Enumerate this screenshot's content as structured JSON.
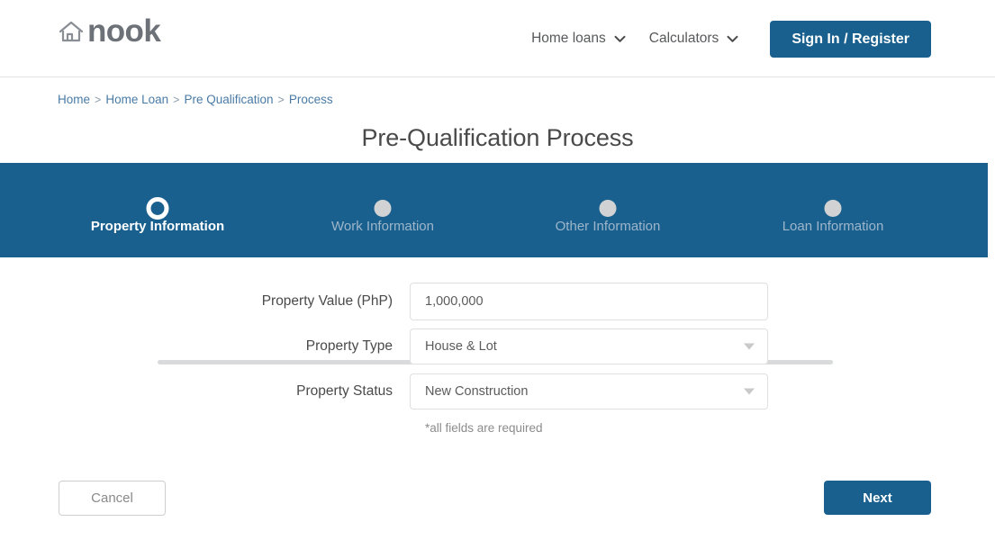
{
  "header": {
    "logo": {
      "icon": "house-icon",
      "text": "nook"
    },
    "nav_items": [
      {
        "label": "Home loans",
        "icon": "chevron-down-icon"
      },
      {
        "label": "Calculators",
        "icon": "chevron-down-icon"
      }
    ],
    "signin_label": "Sign In / Register"
  },
  "breadcrumb": {
    "items": [
      "Home",
      "Home Loan",
      "Pre Qualification",
      "Process"
    ],
    "separator": ">"
  },
  "page_title": "Pre-Qualification Process",
  "stepper": {
    "steps": [
      {
        "label": "Property Information",
        "state": "active"
      },
      {
        "label": "Work Information",
        "state": "inactive"
      },
      {
        "label": "Other Information",
        "state": "inactive"
      },
      {
        "label": "Loan Information",
        "state": "inactive"
      }
    ]
  },
  "form": {
    "fields": [
      {
        "label": "Property Value (PhP)",
        "value": "1,000,000",
        "type": "text",
        "name": "property-value"
      },
      {
        "label": "Property Type",
        "value": "House & Lot",
        "type": "select",
        "name": "property-type"
      },
      {
        "label": "Property Status",
        "value": "New Construction",
        "type": "select",
        "name": "property-status"
      }
    ],
    "required_note": "*all fields are required"
  },
  "footer": {
    "cancel_label": "Cancel",
    "next_label": "Next"
  },
  "colors": {
    "brand_blue": "#1a608f",
    "band_blue": "#1a608f",
    "breadcrumb_link": "#4a7ba6",
    "logo_gray": "#6d7278",
    "inactive_step": "#9db6ca",
    "inactive_dot": "#d1d2d3",
    "track_gray": "#d9dadb"
  }
}
